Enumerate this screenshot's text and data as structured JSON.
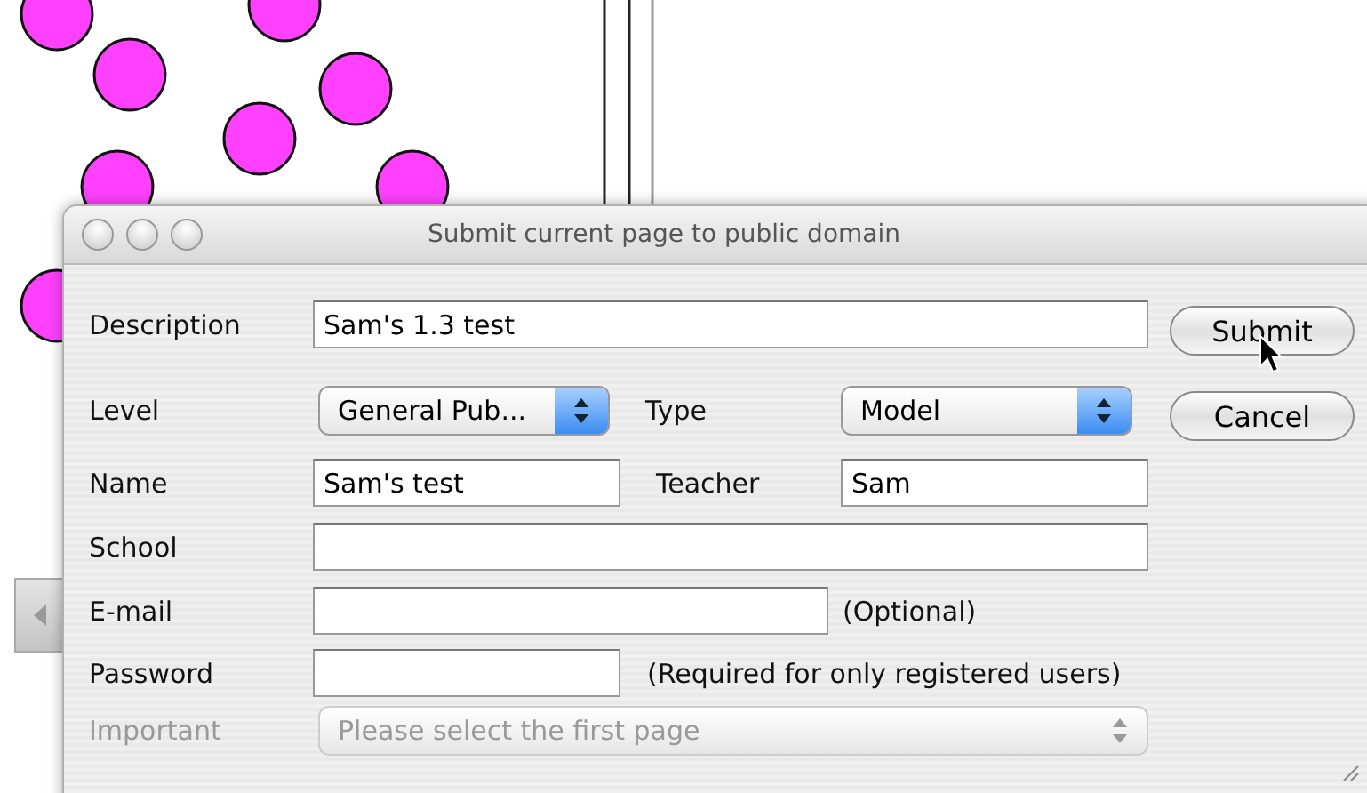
{
  "window": {
    "title": "Submit current page to public domain"
  },
  "rows": [
    {
      "kind": "wide",
      "label": "Description",
      "disabled": false,
      "fields": [
        {
          "kind": "text",
          "value": "Sam's 1.3 test"
        }
      ]
    },
    {
      "kind": "pair",
      "label": "Level",
      "disabled": false,
      "fields": [
        {
          "kind": "select",
          "value": "General Pub..."
        },
        {
          "kind": "select",
          "label": "Type",
          "value": "Model"
        }
      ]
    },
    {
      "kind": "pair",
      "label": "Name",
      "disabled": false,
      "fields": [
        {
          "kind": "text",
          "value": "Sam's test"
        },
        {
          "kind": "text",
          "label": "Teacher",
          "value": "Sam"
        }
      ]
    },
    {
      "kind": "wide",
      "label": "School",
      "disabled": false,
      "fields": [
        {
          "kind": "text"
        }
      ]
    },
    {
      "kind": "note",
      "label": "E-mail",
      "disabled": false,
      "note": "(Optional)",
      "fields": [
        {
          "kind": "text"
        }
      ]
    },
    {
      "kind": "note",
      "label": "Password",
      "disabled": false,
      "note": "(Required for only registered users)",
      "fields": [
        {
          "kind": "password"
        }
      ]
    },
    {
      "kind": "wide",
      "label": "Important",
      "disabled": true,
      "fields": [
        {
          "kind": "select",
          "value": "Please select the first page"
        }
      ]
    }
  ],
  "buttons": [
    "Submit",
    "Cancel"
  ]
}
